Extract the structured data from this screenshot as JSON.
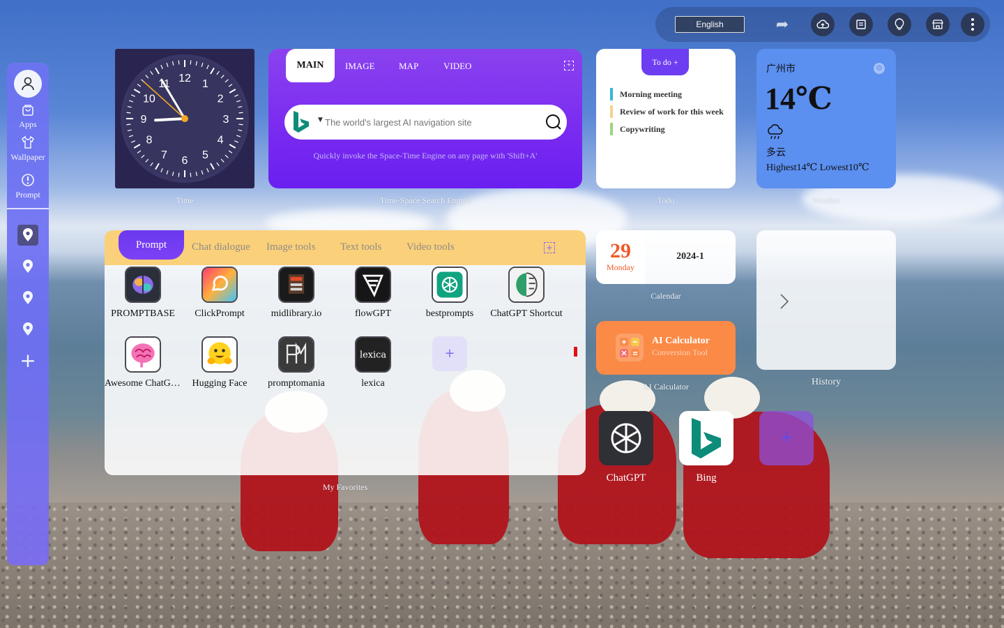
{
  "topbar": {
    "language": "English",
    "icons": [
      "share-icon",
      "cloud-upload-icon",
      "note-icon",
      "lightbulb-icon",
      "store-icon",
      "more-vertical-icon"
    ]
  },
  "sidebar": {
    "items": [
      {
        "label": "Apps",
        "icon": "bag-icon"
      },
      {
        "label": "Wallpaper",
        "icon": "shirt-icon"
      },
      {
        "label": "Prompt",
        "icon": "alert-circle-icon"
      }
    ],
    "pins": [
      "location-pin-icon",
      "location-pin-icon",
      "location-pin-icon",
      "location-pin-icon"
    ],
    "add_label": "+"
  },
  "clock": {
    "label": "Time",
    "numbers": [
      "12",
      "1",
      "2",
      "3",
      "4",
      "5",
      "6",
      "7",
      "8",
      "9",
      "10",
      "11"
    ],
    "hour": 8,
    "minute": 54,
    "second": 52
  },
  "search": {
    "tabs": [
      "MAIN",
      "IMAGE",
      "MAP",
      "VIDEO"
    ],
    "placeholder": "The world's largest AI navigation site",
    "hint": "Quickly invoke the Space-Time Engine on any page with 'Shift+A'",
    "label": "Time-Space Search Engine"
  },
  "todo": {
    "tab": "To do +",
    "items": [
      {
        "text": "Morning meeting",
        "color": "#35b8d8"
      },
      {
        "text": "Review of work for this week",
        "color": "#f5d28a"
      },
      {
        "text": "Copywriting",
        "color": "#9ad67c"
      }
    ],
    "label": "Todo"
  },
  "weather": {
    "city": "广州市",
    "temp": "14℃",
    "condition": "多云",
    "range": "Highest14℃ Lowest10℃",
    "label": "Weather",
    "icon": "rain-cloud-icon"
  },
  "favorites": {
    "tabs": [
      "Prompt",
      "Chat dialogue",
      "Image tools",
      "Text tools",
      "Video tools"
    ],
    "add": "+",
    "apps": [
      {
        "name": "PROMPTBASE",
        "icon": "promptbase-icon"
      },
      {
        "name": "ClickPrompt",
        "icon": "clickprompt-icon"
      },
      {
        "name": "midlibrary.io",
        "icon": "midlibrary-icon"
      },
      {
        "name": "flowGPT",
        "icon": "flowgpt-icon"
      },
      {
        "name": "bestprompts",
        "icon": "bestprompts-icon"
      },
      {
        "name": "ChatGPT Shortcut",
        "icon": "chatgpt-shortcut-icon"
      },
      {
        "name": "Awesome ChatGPT Prompts",
        "icon": "awesome-chatgpt-icon"
      },
      {
        "name": "Hugging Face",
        "icon": "hugging-face-icon"
      },
      {
        "name": "promptomania",
        "icon": "promptomania-icon"
      },
      {
        "name": "lexica",
        "icon": "lexica-icon"
      }
    ],
    "add_app": "+",
    "label": "My Favorites"
  },
  "calendar": {
    "day": "29",
    "weekday": "Monday",
    "year_month": "2024-1",
    "label": "Calendar"
  },
  "calculator": {
    "title": "AI Calculator",
    "subtitle": "Conversion Tool",
    "label": "AI Calculator"
  },
  "history": {
    "label": "History"
  },
  "dock": {
    "items": [
      {
        "name": "ChatGPT",
        "icon": "chatgpt-icon"
      },
      {
        "name": "Bing",
        "icon": "bing-icon"
      }
    ],
    "add": "+"
  }
}
